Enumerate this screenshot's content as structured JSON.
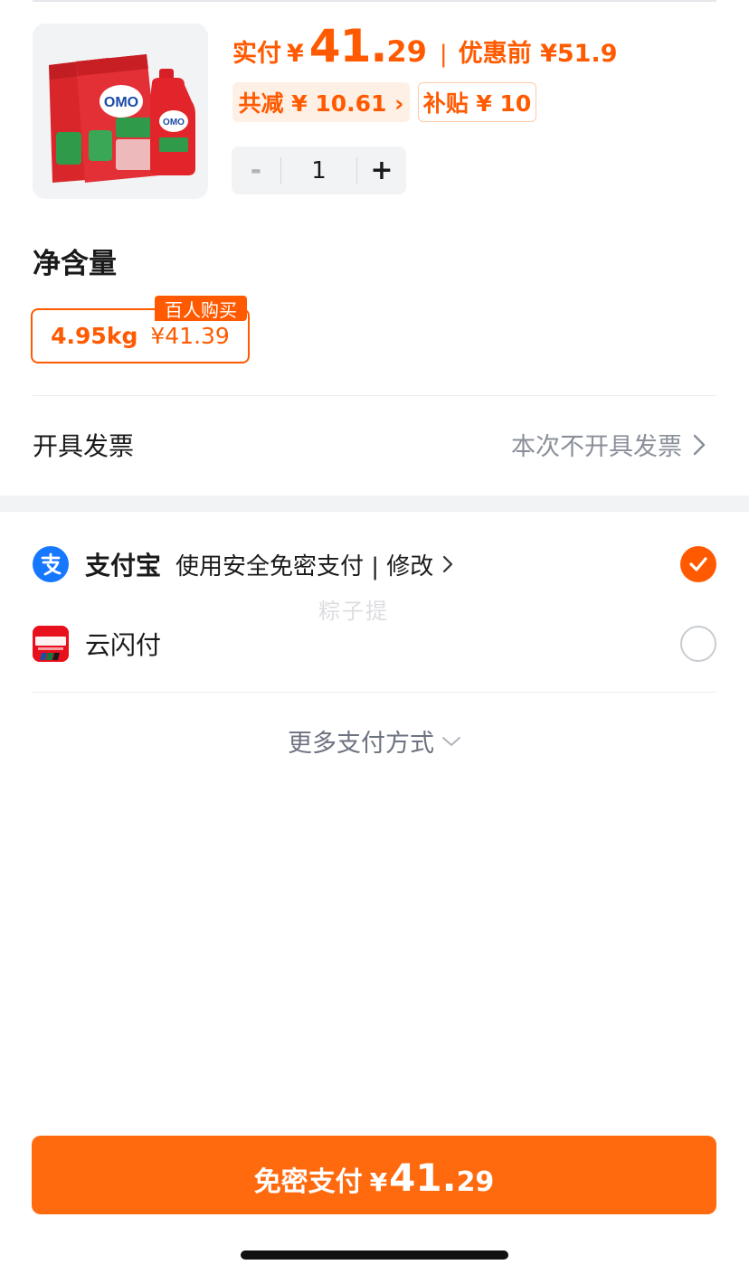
{
  "product": {
    "image_alt": "OMO",
    "brand_text": "OMO"
  },
  "price": {
    "paid_label": "实付",
    "currency": "¥",
    "paid_integer": "41.",
    "paid_decimal": "29",
    "separator": "|",
    "original_label": "优惠前 ¥51.9",
    "discount_chip": "共减 ¥ 10.61 ›",
    "subsidy_chip": "补贴 ¥ 10"
  },
  "quantity": {
    "minus": "-",
    "value": "1",
    "plus": "+"
  },
  "spec": {
    "title": "净含量",
    "option_weight": "4.95kg",
    "option_price": "¥41.39",
    "badge": "百人购买"
  },
  "invoice": {
    "label": "开具发票",
    "value": "本次不开具发票"
  },
  "payment": {
    "alipay_name": "支付宝",
    "alipay_desc": "使用安全免密支付 | 修改",
    "alipay_selected": true,
    "unionpay_name": "云闪付",
    "unionpay_selected": false,
    "watermark": "粽子提",
    "more": "更多支付方式"
  },
  "pay_button": {
    "label": "免密支付",
    "currency": "¥",
    "amount_integer": "41.",
    "amount_decimal": "29"
  },
  "colors": {
    "accent": "#ff5a00",
    "alipay_blue": "#1677ff",
    "unionpay_red": "#e8101c"
  }
}
